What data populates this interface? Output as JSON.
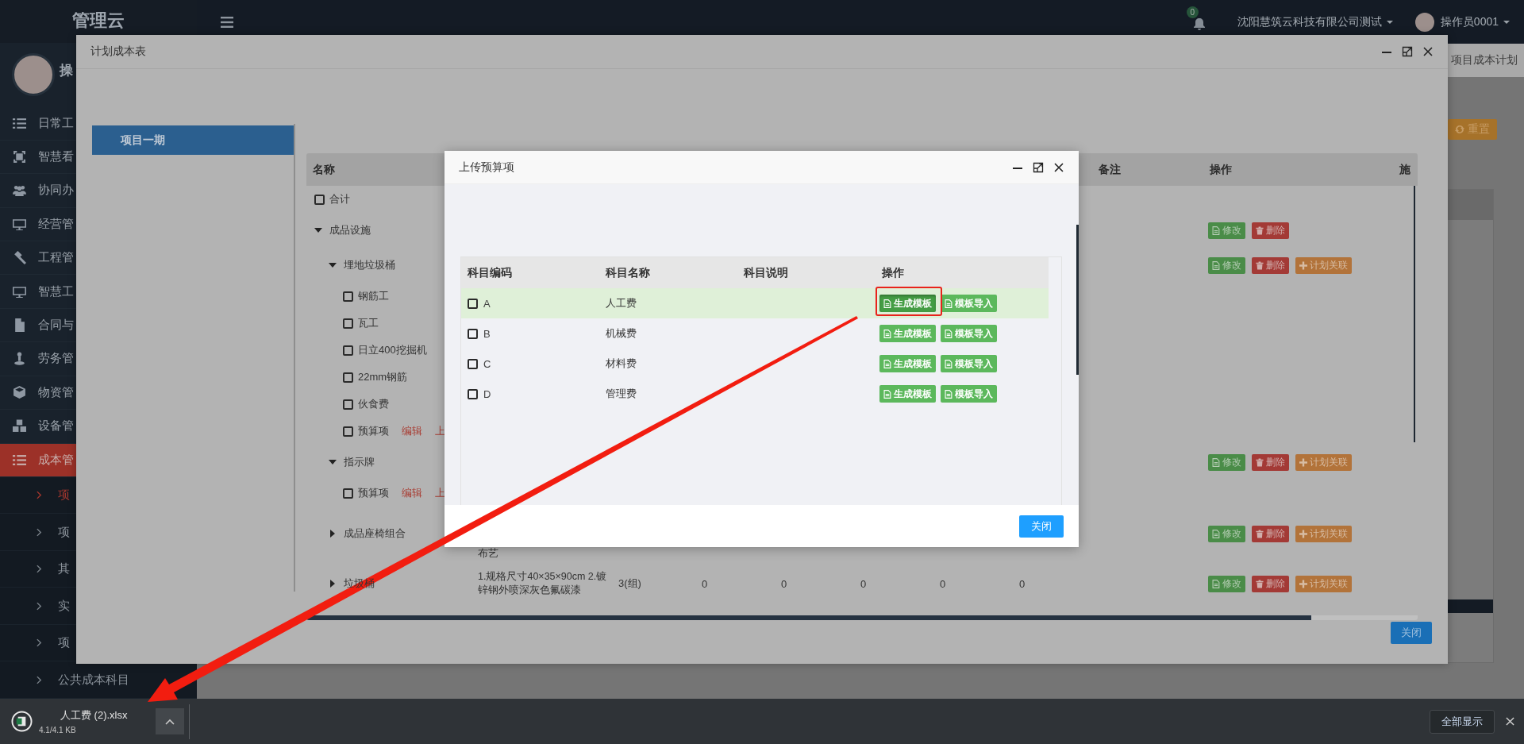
{
  "sidebar": {
    "brand": "管理云",
    "user_name": "操",
    "items": [
      {
        "label": "日常工",
        "selected": false
      },
      {
        "label": "智慧看",
        "selected": false
      },
      {
        "label": "协同办",
        "selected": false
      },
      {
        "label": "经营管",
        "selected": false
      },
      {
        "label": "工程管",
        "selected": false
      },
      {
        "label": "智慧工",
        "selected": false
      },
      {
        "label": "合同与",
        "selected": false
      },
      {
        "label": "劳务管",
        "selected": false
      },
      {
        "label": "物资管",
        "selected": false
      },
      {
        "label": "设备管",
        "selected": false
      },
      {
        "label": "成本管",
        "selected": true,
        "expanded": true,
        "children": [
          {
            "label": "项",
            "selected": true
          },
          {
            "label": "项",
            "selected": false
          },
          {
            "label": "其",
            "selected": false
          },
          {
            "label": "实",
            "selected": false
          },
          {
            "label": "项",
            "selected": false
          },
          {
            "label": "公共成本科目",
            "selected": false
          }
        ]
      }
    ]
  },
  "topbar": {
    "notification_count": "0",
    "company": "沈阳慧筑云科技有限公司测试",
    "user": "操作员0001"
  },
  "page": {
    "breadcrumb": "项目成本计划",
    "reset_button": "重置"
  },
  "cost_plan_dialog": {
    "title": "计划成本表",
    "projects": [
      {
        "label": "项目一期",
        "selected": true
      }
    ],
    "table": {
      "headers": {
        "name": "名称",
        "remarks": "备注",
        "actions": "操作",
        "column_4": "施"
      },
      "rows": [
        {
          "name": "合计",
          "kind": "leaf",
          "checked": false
        },
        {
          "name": "成品设施",
          "kind": "group",
          "expanded": true,
          "actions": [
            {
              "label": "修改",
              "kind": "edit"
            },
            {
              "label": "删除",
              "kind": "delete"
            }
          ],
          "children": [
            {
              "name": "埋地垃圾桶",
              "kind": "group",
              "expanded": true,
              "actions": [
                {
                  "label": "修改",
                  "kind": "edit"
                },
                {
                  "label": "删除",
                  "kind": "delete"
                },
                {
                  "label": "计划关联",
                  "kind": "link"
                }
              ],
              "children": [
                {
                  "name": "钢筋工",
                  "kind": "leaf",
                  "checked": false
                },
                {
                  "name": "瓦工",
                  "kind": "leaf",
                  "checked": false
                },
                {
                  "name": "日立400挖掘机",
                  "kind": "leaf",
                  "checked": false
                },
                {
                  "name": "22mm钢筋",
                  "kind": "leaf",
                  "checked": false
                },
                {
                  "name": "伙食费",
                  "kind": "leaf",
                  "checked": false
                },
                {
                  "name": "预算项",
                  "kind": "leaf",
                  "checked": false,
                  "links": [
                    "编辑",
                    "上"
                  ]
                }
              ]
            },
            {
              "name": "指示牌",
              "kind": "group",
              "expanded": true,
              "actions": [
                {
                  "label": "修改",
                  "kind": "edit"
                },
                {
                  "label": "删除",
                  "kind": "delete"
                },
                {
                  "label": "计划关联",
                  "kind": "link"
                }
              ],
              "children": [
                {
                  "name": "预算项",
                  "kind": "leaf",
                  "checked": false,
                  "links": [
                    "编辑",
                    "上"
                  ]
                }
              ]
            },
            {
              "name": "成品座椅组合",
              "kind": "group",
              "expanded": false,
              "description_tail": "布艺",
              "actions": [
                {
                  "label": "修改",
                  "kind": "edit"
                },
                {
                  "label": "删除",
                  "kind": "delete"
                },
                {
                  "label": "计划关联",
                  "kind": "link"
                }
              ]
            },
            {
              "name": "垃圾桶",
              "kind": "group",
              "expanded": false,
              "description": "1.规格尺寸40×35×90cm 2.镀锌钢外喷深灰色氟碳漆",
              "quantity": "3(组)",
              "values": [
                "0",
                "0",
                "0",
                "0",
                "0"
              ],
              "actions": [
                {
                  "label": "修改",
                  "kind": "edit"
                },
                {
                  "label": "删除",
                  "kind": "delete"
                },
                {
                  "label": "计划关联",
                  "kind": "link"
                }
              ]
            }
          ]
        }
      ]
    },
    "close_button": "关闭"
  },
  "upload_dialog": {
    "title": "上传预算项",
    "columns": [
      "科目编码",
      "科目名称",
      "科目说明",
      "操作"
    ],
    "rows": [
      {
        "code": "A",
        "name": "人工费",
        "selected": true,
        "checked": false,
        "actions": [
          {
            "label": "生成模板",
            "active": true
          },
          {
            "label": "模板导入",
            "active": false
          }
        ]
      },
      {
        "code": "B",
        "name": "机械费",
        "selected": false,
        "checked": false,
        "actions": [
          {
            "label": "生成模板",
            "active": false
          },
          {
            "label": "模板导入",
            "active": false
          }
        ]
      },
      {
        "code": "C",
        "name": "材料费",
        "selected": false,
        "checked": false,
        "actions": [
          {
            "label": "生成模板",
            "active": false
          },
          {
            "label": "模板导入",
            "active": false
          }
        ]
      },
      {
        "code": "D",
        "name": "管理费",
        "selected": false,
        "checked": false,
        "actions": [
          {
            "label": "生成模板",
            "active": false
          },
          {
            "label": "模板导入",
            "active": false
          }
        ]
      }
    ],
    "close_button": "关闭"
  },
  "download_bar": {
    "file_name": "人工费 (2).xlsx",
    "progress": "4.1/4.1 KB",
    "show_all": "全部显示"
  }
}
